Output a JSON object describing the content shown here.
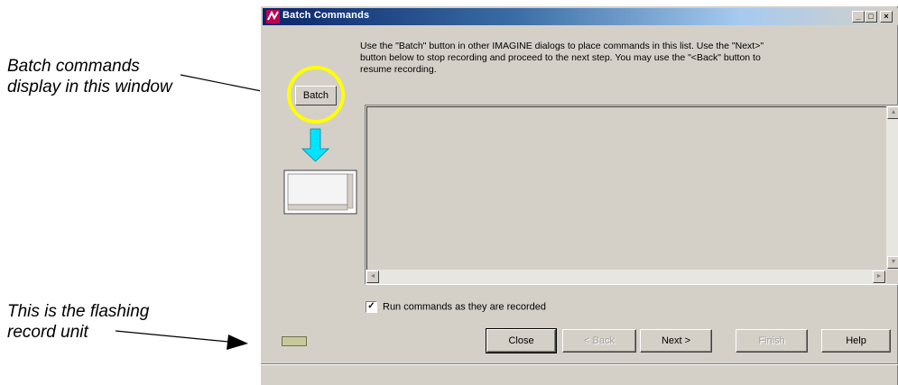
{
  "callouts": {
    "batch_display": "Batch commands\ndisplay in this window",
    "record_unit": "This is the flashing\nrecord unit"
  },
  "window": {
    "title": "Batch Commands",
    "title_icon": "imagine-app-icon",
    "controls": {
      "minimize": "_",
      "maximize": "□",
      "close": "×"
    }
  },
  "info_text": "Use the \"Batch\" button in other IMAGINE dialogs to place commands in this list. Use the \"Next>\" button below to stop recording and proceed to the next step. You may use the \"<Back\" button to resume recording.",
  "diagram": {
    "batch_button_label": "Batch",
    "highlight_color": "#ffff00",
    "arrow_color": "#00e5ff"
  },
  "checkbox": {
    "label": "Run commands as they are recorded",
    "checked": true,
    "mark": "✓"
  },
  "buttons": {
    "close": "Close",
    "back": "< Back",
    "next": "Next >",
    "finish": "Finish",
    "help": "Help"
  },
  "scroll_glyphs": {
    "up": "▲",
    "down": "▼",
    "left": "◄",
    "right": "►"
  }
}
